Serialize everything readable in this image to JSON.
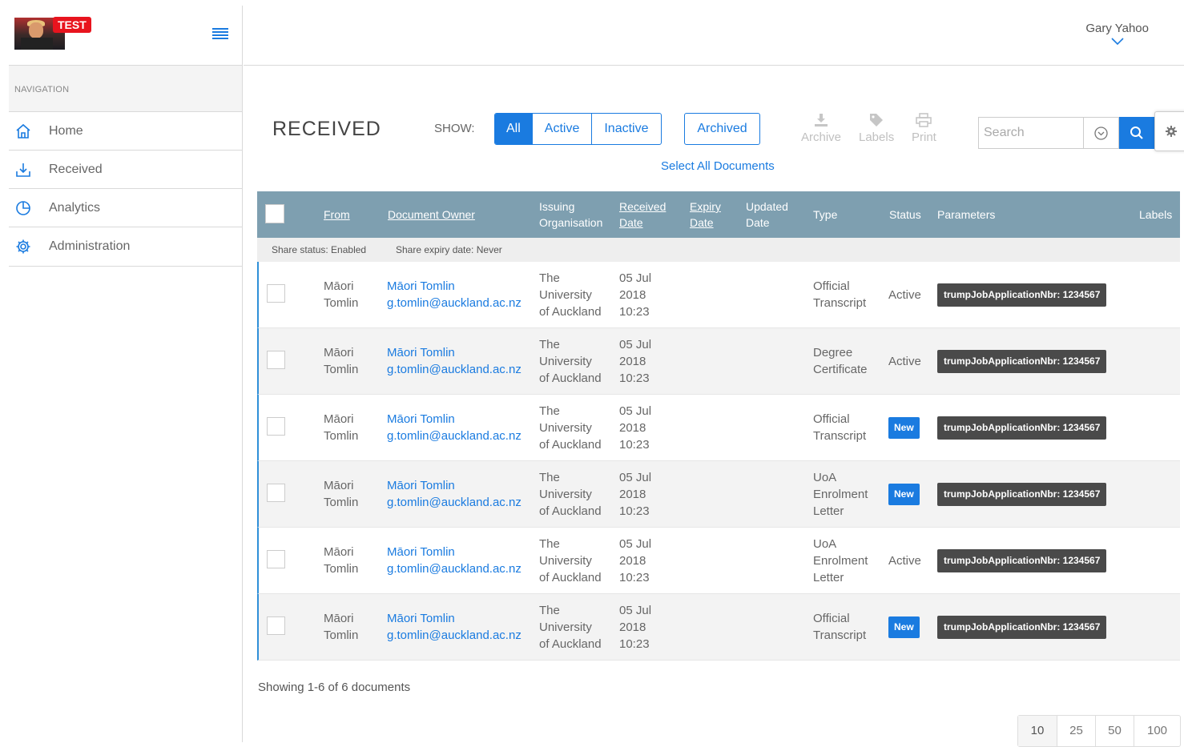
{
  "brand": {
    "test_badge": "TEST"
  },
  "sidebar": {
    "heading": "NAVIGATION",
    "items": [
      {
        "label": "Home",
        "icon": "home-icon"
      },
      {
        "label": "Received",
        "icon": "download-icon"
      },
      {
        "label": "Analytics",
        "icon": "pie-chart-icon"
      },
      {
        "label": "Administration",
        "icon": "gear-icon"
      }
    ]
  },
  "header": {
    "user_name": "Gary Yahoo"
  },
  "main": {
    "title": "RECEIVED",
    "show_label": "SHOW:",
    "filters": [
      "All",
      "Active",
      "Inactive"
    ],
    "active_filter": "All",
    "archived_label": "Archived",
    "select_all_label": "Select All Documents",
    "tools": {
      "archive": "Archive",
      "labels": "Labels",
      "print": "Print"
    },
    "search_placeholder": "Search"
  },
  "colors": {
    "accent": "#1a7be0",
    "header_bg": "#7e9fb0",
    "param_badge": "#4a4a4a",
    "test_badge": "#e8141e"
  },
  "table": {
    "columns": {
      "from": "From",
      "owner": "Document Owner",
      "issuing_1": "Issuing",
      "issuing_2": "Organisation",
      "received_1": "Received",
      "received_2": "Date",
      "expiry_1": "Expiry",
      "expiry_2": "Date",
      "updated_1": "Updated",
      "updated_2": "Date",
      "type": "Type",
      "status": "Status",
      "parameters": "Parameters",
      "labels": "Labels"
    },
    "share_status": "Share status: Enabled",
    "share_expiry": "Share expiry date: Never",
    "rows": [
      {
        "from_1": "Māori",
        "from_2": "Tomlin",
        "owner_name": "Māori Tomlin",
        "owner_email": "g.tomlin@auckland.ac.nz",
        "org_1": "The",
        "org_2": "University",
        "org_3": "of Auckland",
        "date_1": "05 Jul",
        "date_2": "2018",
        "date_3": "10:23",
        "type_1": "Official",
        "type_2": "Transcript",
        "type_3": "",
        "status": "Active",
        "status_is_new": false,
        "param": "trumpJobApplicationNbr: 1234567"
      },
      {
        "from_1": "Māori",
        "from_2": "Tomlin",
        "owner_name": "Māori Tomlin",
        "owner_email": "g.tomlin@auckland.ac.nz",
        "org_1": "The",
        "org_2": "University",
        "org_3": "of Auckland",
        "date_1": "05 Jul",
        "date_2": "2018",
        "date_3": "10:23",
        "type_1": "Degree",
        "type_2": "Certificate",
        "type_3": "",
        "status": "Active",
        "status_is_new": false,
        "param": "trumpJobApplicationNbr: 1234567"
      },
      {
        "from_1": "Māori",
        "from_2": "Tomlin",
        "owner_name": "Māori Tomlin",
        "owner_email": "g.tomlin@auckland.ac.nz",
        "org_1": "The",
        "org_2": "University",
        "org_3": "of Auckland",
        "date_1": "05 Jul",
        "date_2": "2018",
        "date_3": "10:23",
        "type_1": "Official",
        "type_2": "Transcript",
        "type_3": "",
        "status": "New",
        "status_is_new": true,
        "param": "trumpJobApplicationNbr: 1234567"
      },
      {
        "from_1": "Māori",
        "from_2": "Tomlin",
        "owner_name": "Māori Tomlin",
        "owner_email": "g.tomlin@auckland.ac.nz",
        "org_1": "The",
        "org_2": "University",
        "org_3": "of Auckland",
        "date_1": "05 Jul",
        "date_2": "2018",
        "date_3": "10:23",
        "type_1": "UoA",
        "type_2": "Enrolment",
        "type_3": "Letter",
        "status": "New",
        "status_is_new": true,
        "param": "trumpJobApplicationNbr: 1234567"
      },
      {
        "from_1": "Māori",
        "from_2": "Tomlin",
        "owner_name": "Māori Tomlin",
        "owner_email": "g.tomlin@auckland.ac.nz",
        "org_1": "The",
        "org_2": "University",
        "org_3": "of Auckland",
        "date_1": "05 Jul",
        "date_2": "2018",
        "date_3": "10:23",
        "type_1": "UoA",
        "type_2": "Enrolment",
        "type_3": "Letter",
        "status": "Active",
        "status_is_new": false,
        "param": "trumpJobApplicationNbr: 1234567"
      },
      {
        "from_1": "Māori",
        "from_2": "Tomlin",
        "owner_name": "Māori Tomlin",
        "owner_email": "g.tomlin@auckland.ac.nz",
        "org_1": "The",
        "org_2": "University",
        "org_3": "of Auckland",
        "date_1": "05 Jul",
        "date_2": "2018",
        "date_3": "10:23",
        "type_1": "Official",
        "type_2": "Transcript",
        "type_3": "",
        "status": "New",
        "status_is_new": true,
        "param": "trumpJobApplicationNbr: 1234567"
      }
    ]
  },
  "footer": {
    "showing": "Showing 1-6 of 6 documents",
    "page_sizes": [
      "10",
      "25",
      "50",
      "100"
    ],
    "selected_page_size": "10"
  }
}
